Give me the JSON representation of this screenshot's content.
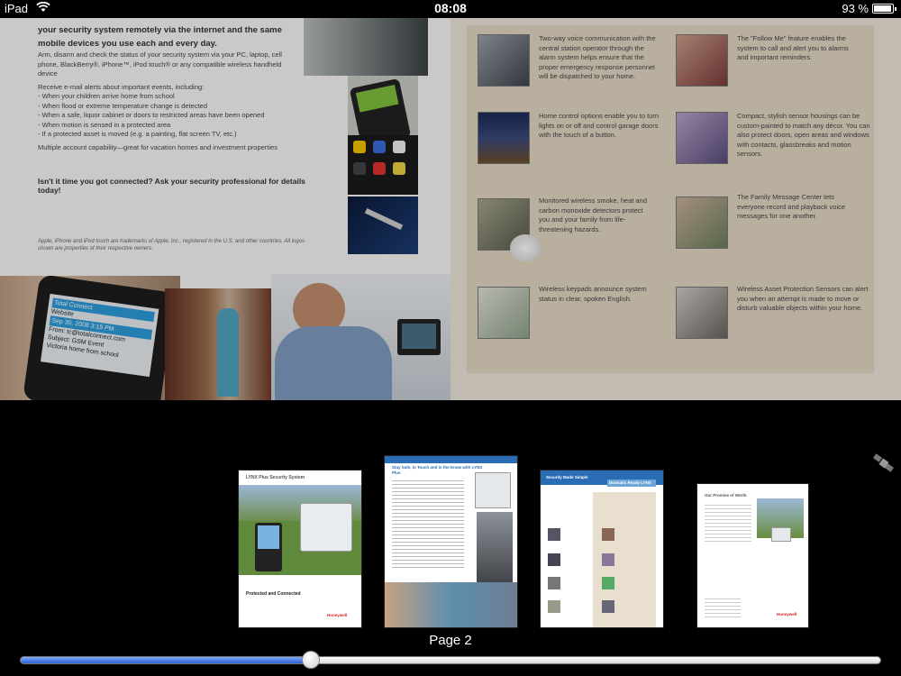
{
  "status_bar": {
    "device": "iPad",
    "time": "08:08",
    "battery": "93 %",
    "battery_level": 0.93
  },
  "left_page": {
    "intro": "your security system remotely via the internet and the same mobile devices you use each and every day.",
    "bullets": [
      "Arm, disarm and check the status of your security system via your PC, laptop, cell phone, BlackBerry®, iPhone™, iPod touch® or any compatible wireless handheld device",
      "Receive e-mail alerts about important events, including:",
      "- When your children arrive home from school",
      "- When flood or extreme temperature change is detected",
      "- When a safe, liquor cabinet or doors to restricted areas have been opened",
      "- When motion is sensed in a protected area",
      "- If a protected asset is moved (e.g. a painting, flat screen TV, etc.)",
      "Multiple account capability—great for vacation homes and investment properties"
    ],
    "cta": "Isn't it time you got connected? Ask your security professional for details today!",
    "legal": "Apple, iPhone and iPod touch are trademarks of Apple, Inc., registered in the U.S. and other countries. All logos shown are properties of their respective owners.",
    "phone_screen": [
      "Total Connect",
      "Website",
      "Sep 30, 2008 3:19 PM",
      "From: tc@totalconnect.com",
      "Subject: GSM Event",
      "Victoria home from school"
    ]
  },
  "right_page": {
    "features": [
      "Two-way voice communication with the central station operator through the alarm system helps ensure that the proper emergency response personnel will be dispatched to your home.",
      "The \"Follow Me\" feature enables the system to call and alert you to alarms and important reminders.",
      "Home control options enable you to turn lights on or off and control garage doors with the touch of a button.",
      "Compact, stylish sensor housings can be custom-painted to match any décor. You can also protect doors, open areas and windows with contacts, glassbreaks and motion sensors.",
      "Monitored wireless smoke, heat and carbon monoxide detectors protect you and your family from life-threatening hazards.",
      "The Family Message Center lets everyone record and playback voice messages for one another.",
      "Wireless keypads announce system status in clear, spoken English.",
      "Wireless Asset Protection Sensors can alert you when an attempt is made to move or disturb valuable objects within your home."
    ]
  },
  "thumbnails": [
    {
      "title": "LYNX Plus Security System",
      "caption": "Protected and Connected",
      "brand": "Honeywell"
    },
    {
      "title": "Stay Safe, in Touch and in the Know with LYNX Plus"
    },
    {
      "title": "Security Made Simple",
      "banner": "Dramatic Ready LYNX"
    },
    {
      "title": "Our Promise of Worth",
      "brand": "Honeywell"
    }
  ],
  "page_indicator": "Page 2",
  "slider": {
    "position": 0.337
  }
}
